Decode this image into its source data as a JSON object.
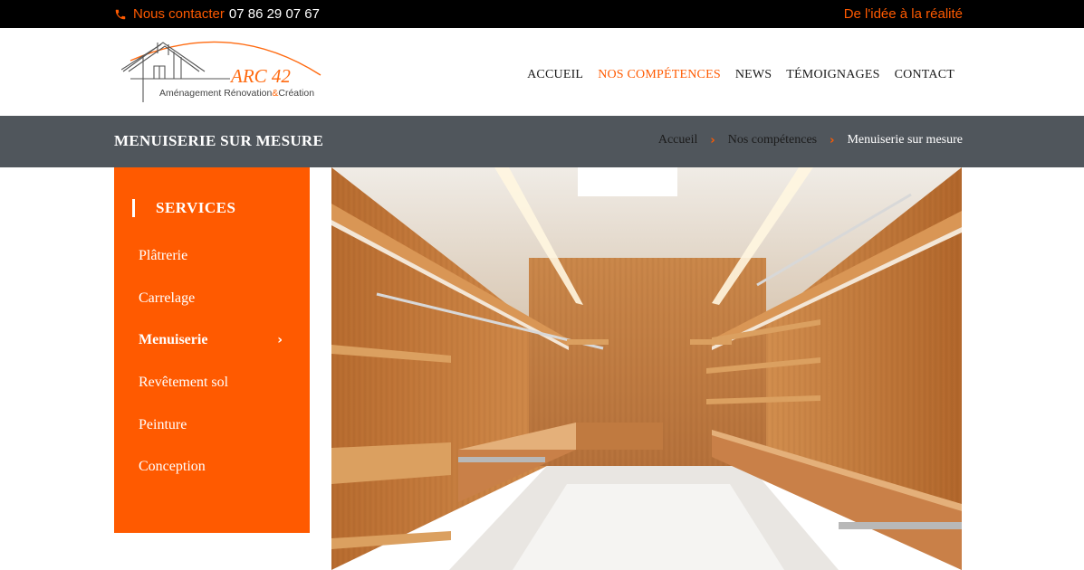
{
  "topbar": {
    "contact_label": "Nous contacter",
    "phone": "07 86 29 07 67",
    "tagline": "De l'idée à la réalité"
  },
  "logo": {
    "brand": "ARC 42",
    "subtitle_a": "Aménagement Rénovation",
    "subtitle_amp": "&",
    "subtitle_b": "Création"
  },
  "nav": {
    "items": [
      {
        "label": "ACCUEIL"
      },
      {
        "label": "NOS COMPÉTENCES"
      },
      {
        "label": "NEWS"
      },
      {
        "label": "TÉMOIGNAGES"
      },
      {
        "label": "CONTACT"
      }
    ]
  },
  "page": {
    "title": "MENUISERIE SUR MESURE"
  },
  "breadcrumb": {
    "items": [
      "Accueil",
      "Nos compétences",
      "Menuiserie sur mesure"
    ]
  },
  "sidebar": {
    "heading": "SERVICES",
    "items": [
      {
        "label": "Plâtrerie"
      },
      {
        "label": "Carrelage"
      },
      {
        "label": "Menuiserie"
      },
      {
        "label": "Revêtement sol"
      },
      {
        "label": "Peinture"
      },
      {
        "label": "Conception"
      }
    ]
  },
  "colors": {
    "accent": "#ff5a00",
    "topbar_bg": "#000000",
    "titlebar_bg": "#50565c"
  },
  "icons": {
    "phone": "phone-icon",
    "chevron": "chevron-right-icon"
  }
}
